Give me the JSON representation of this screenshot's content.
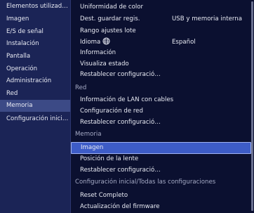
{
  "sidebar": {
    "items": [
      {
        "label": "Elementos utilizados fr..."
      },
      {
        "label": "Imagen"
      },
      {
        "label": "E/S de señal"
      },
      {
        "label": "Instalación"
      },
      {
        "label": "Pantalla"
      },
      {
        "label": "Operación"
      },
      {
        "label": "Administración"
      },
      {
        "label": "Red"
      },
      {
        "label": "Memoria",
        "selected": true
      },
      {
        "label": "Configuración inicial/T..."
      }
    ]
  },
  "main": {
    "rows": [
      {
        "label": "Uniformidad de color"
      },
      {
        "label": "Dest. guardar regis.",
        "value": "USB y memoria interna"
      },
      {
        "label": "Rango ajustes lote"
      },
      {
        "label": "Idioma",
        "icon": "globe-icon",
        "value": "Español"
      },
      {
        "label": "Información"
      },
      {
        "label": "Visualiza estado"
      },
      {
        "label": "Restablecer configuración de..."
      },
      {
        "section": "Red"
      },
      {
        "label": "Información de LAN con cables"
      },
      {
        "label": "Configuración de red"
      },
      {
        "label": "Restablecer configuración de..."
      },
      {
        "section": "Memoria"
      },
      {
        "label": "Imagen",
        "selected": true
      },
      {
        "label": "Posición de la lente"
      },
      {
        "label": "Restablecer configuración de..."
      },
      {
        "section": "Configuración inicial/Todas las configuraciones"
      },
      {
        "label": "Reset Completo"
      },
      {
        "label": "Actualización del firmware"
      }
    ]
  },
  "colors": {
    "background": "#0b1030",
    "sidebar": "#1b2456",
    "sidebar_selected": "#3c4a86",
    "row_selected": "#3d5cc7"
  }
}
